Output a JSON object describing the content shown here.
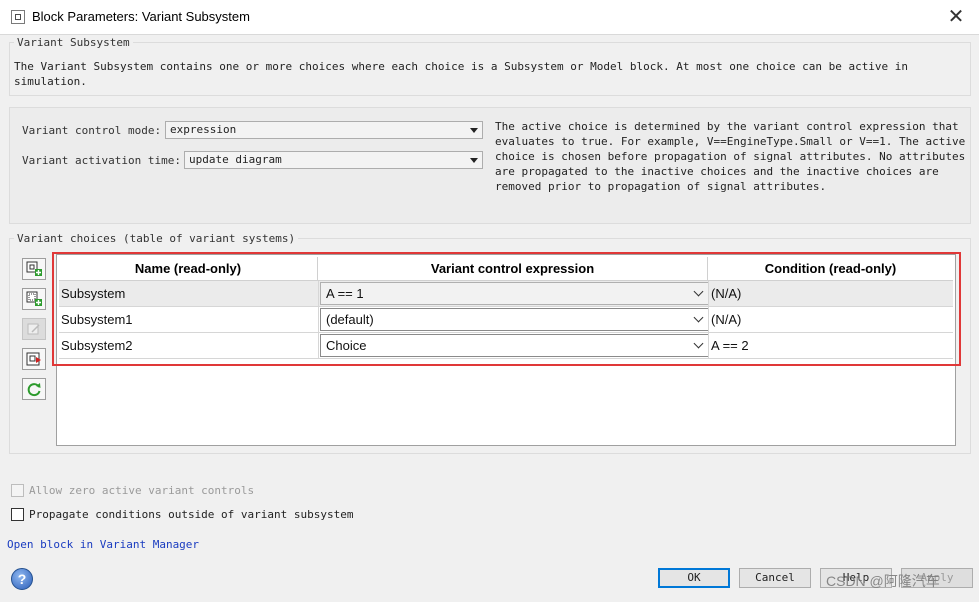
{
  "window": {
    "title": "Block Parameters: Variant Subsystem",
    "close_glyph": "✕"
  },
  "group_main": {
    "legend": "Variant Subsystem",
    "description_line1": "The Variant Subsystem contains one or more choices where each choice is a Subsystem or Model block. At most one choice can be active in",
    "description_line2": "simulation."
  },
  "controls": {
    "mode_label": "Variant control mode:",
    "mode_value": "expression",
    "activation_label": "Variant activation time:",
    "activation_value": "update diagram",
    "info_lines": [
      "The active choice is determined by the variant control expression that",
      "evaluates to true. For example, V==EngineType.Small or V==1. The active",
      "choice is chosen before propagation of signal attributes. No attributes",
      "are propagated to the inactive choices and the inactive choices are",
      "removed prior to propagation of signal attributes."
    ]
  },
  "choices": {
    "legend": "Variant choices (table of variant systems)",
    "headers": [
      "Name (read-only)",
      "Variant control expression",
      "Condition (read-only)"
    ],
    "rows": [
      {
        "name": "Subsystem",
        "expression": "A == 1",
        "condition": "(N/A)"
      },
      {
        "name": "Subsystem1",
        "expression": "(default)",
        "condition": "(N/A)"
      },
      {
        "name": "Subsystem2",
        "expression": "Choice",
        "condition": "A == 2"
      }
    ]
  },
  "options": {
    "allow_zero_label": "Allow zero active variant controls",
    "propagate_label": "Propagate conditions outside of variant subsystem"
  },
  "link_text": "Open block in Variant Manager",
  "help_glyph": "?",
  "buttons": {
    "ok": "OK",
    "cancel": "Cancel",
    "help": "Help",
    "apply": "Apply"
  },
  "watermark": "CSDN @阿隆汽车"
}
